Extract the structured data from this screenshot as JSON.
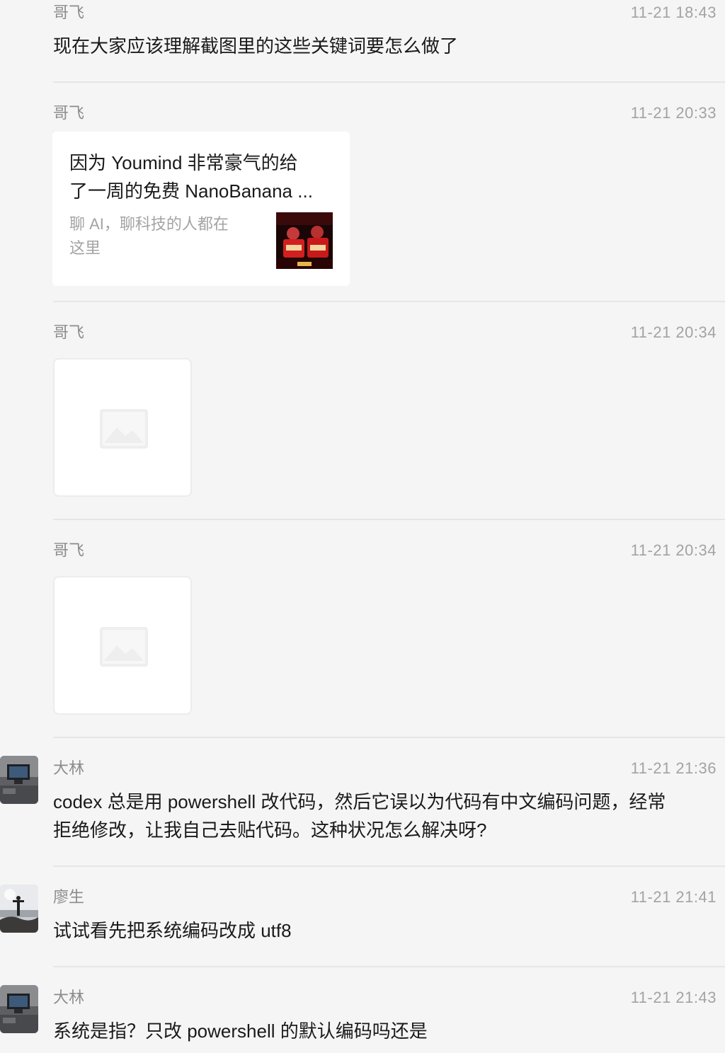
{
  "messages": [
    {
      "sender": "哥飞",
      "time": "11-21 18:43",
      "text": "现在大家应该理解截图里的这些关键词要怎么做了"
    },
    {
      "sender": "哥飞",
      "time": "11-21 20:33",
      "card": {
        "title_line1": "因为 Youmind 非常豪气的给",
        "title_line2": "了一周的免费 NanoBanana ...",
        "desc_line1": "聊 AI，聊科技的人都在",
        "desc_line2": "这里"
      }
    },
    {
      "sender": "哥飞",
      "time": "11-21 20:34",
      "image": "image-placeholder-icon"
    },
    {
      "sender": "哥飞",
      "time": "11-21 20:34",
      "image": "image-placeholder-icon"
    },
    {
      "sender": "大林",
      "time": "11-21 21:36",
      "text_line1": "codex 总是用 powershell 改代码，然后它误以为代码有中文编码问题，经常",
      "text_line2": "拒绝修改，让我自己去贴代码。这种状况怎么解决呀?"
    },
    {
      "sender": "廖生",
      "time": "11-21 21:41",
      "text": "试试看先把系统编码改成 utf8"
    },
    {
      "sender": "大林",
      "time": "11-21 21:43",
      "text": "系统是指？只改 powershell 的默认编码吗还是"
    }
  ],
  "colors": {
    "background": "#f5f5f5",
    "card": "#ffffff",
    "sender": "#8c8c8c",
    "time": "#a3a3a3",
    "text": "#1a1a1a",
    "divider": "#e6e6e6"
  }
}
